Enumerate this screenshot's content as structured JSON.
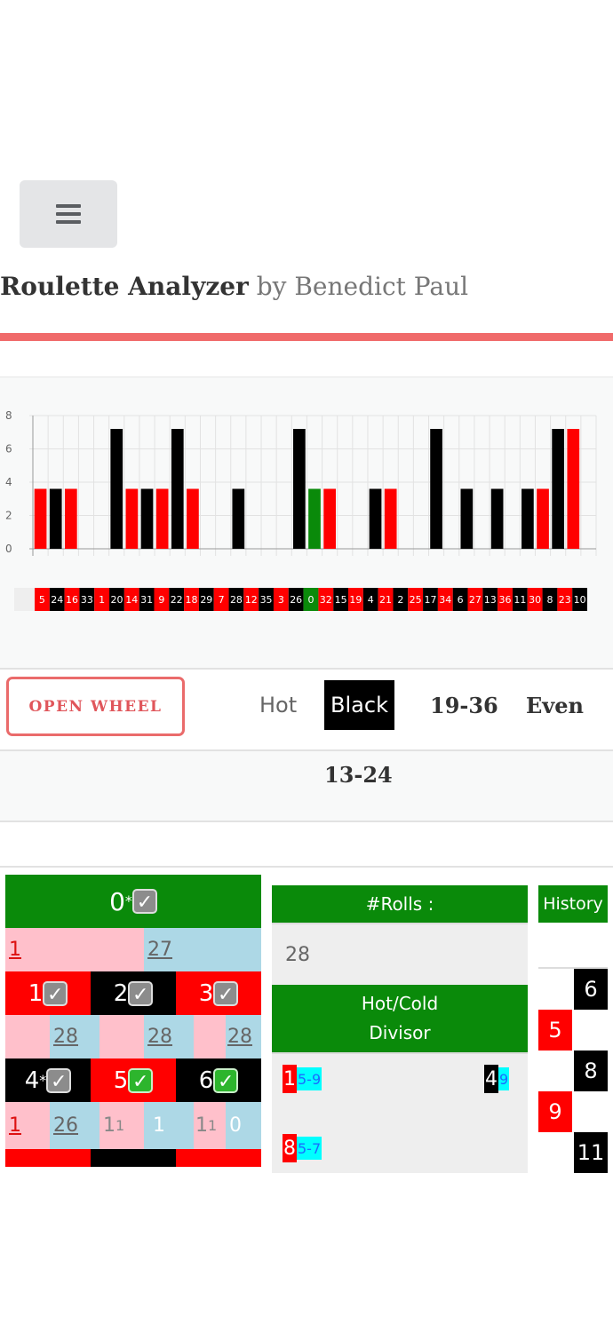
{
  "header": {
    "title": "Roulette Analyzer",
    "byline": "by Benedict Paul"
  },
  "chart_data": {
    "type": "bar",
    "ylim": [
      0,
      8
    ],
    "yticks": [
      "0",
      "2",
      "4",
      "6",
      "8"
    ],
    "grid": true,
    "categories": [
      "5",
      "24",
      "16",
      "33",
      "1",
      "20",
      "14",
      "31",
      "9",
      "22",
      "18",
      "29",
      "7",
      "28",
      "12",
      "35",
      "3",
      "26",
      "0",
      "32",
      "15",
      "19",
      "4",
      "21",
      "2",
      "25",
      "17",
      "34",
      "6",
      "27",
      "13",
      "36",
      "11",
      "30",
      "8",
      "23",
      "10"
    ],
    "colors": [
      "red",
      "black",
      "red",
      "black",
      "red",
      "black",
      "red",
      "black",
      "red",
      "black",
      "red",
      "black",
      "red",
      "black",
      "red",
      "black",
      "red",
      "black",
      "green",
      "red",
      "black",
      "red",
      "black",
      "red",
      "black",
      "red",
      "black",
      "red",
      "black",
      "red",
      "black",
      "red",
      "black",
      "red",
      "black",
      "red",
      "black"
    ],
    "values": [
      3.6,
      3.6,
      3.6,
      0,
      0,
      7.2,
      3.6,
      3.6,
      3.6,
      7.2,
      3.6,
      0,
      0,
      3.6,
      0,
      0,
      0,
      7.2,
      3.6,
      3.6,
      0,
      0,
      3.6,
      3.6,
      0,
      0,
      7.2,
      0,
      3.6,
      0,
      3.6,
      0,
      3.6,
      3.6,
      7.2,
      7.2,
      0
    ]
  },
  "controls": {
    "open_wheel": "OPEN WHEEL",
    "hot": "Hot",
    "color": "Black",
    "range": "19-36",
    "parity": "Even",
    "dozen": "13-24"
  },
  "board": {
    "zero_label": "0",
    "zero_star": "*",
    "rows": [
      {
        "stats": [
          {
            "a": "1",
            "b": "27"
          }
        ],
        "cells": [
          {
            "num": "1",
            "color": "red",
            "star": "",
            "check": "grey"
          },
          {
            "num": "2",
            "color": "black",
            "star": "",
            "check": "grey"
          },
          {
            "num": "3",
            "color": "red",
            "star": "",
            "check": "grey"
          }
        ],
        "sub": [
          "28",
          "28",
          "28"
        ]
      },
      {
        "cells": [
          {
            "num": "4",
            "color": "black",
            "star": "*",
            "check": "grey"
          },
          {
            "num": "5",
            "color": "red",
            "star": "",
            "check": "green"
          },
          {
            "num": "6",
            "color": "black",
            "star": "",
            "check": "green"
          }
        ],
        "sub": [
          {
            "a": "1",
            "b": "26"
          },
          {
            "a": "1",
            "sup": "1",
            "b": "1"
          },
          {
            "a": "1",
            "sup": "1",
            "b": "0"
          }
        ]
      }
    ],
    "check_mark": "✓"
  },
  "rolls": {
    "header": "#Rolls :",
    "value": "28"
  },
  "hotcold": {
    "header_line1": "Hot/Cold",
    "header_line2": "Divisor",
    "items": [
      {
        "num": "1",
        "color": "red",
        "div": "5-9"
      },
      {
        "num": "4",
        "color": "black",
        "div": "9"
      },
      {
        "num": "8",
        "color": "red",
        "div": "5-7"
      }
    ]
  },
  "history": {
    "header": "History",
    "items": [
      {
        "num": "6",
        "color": "black",
        "side": "right"
      },
      {
        "num": "5",
        "color": "red",
        "side": "left"
      },
      {
        "num": "8",
        "color": "black",
        "side": "right"
      },
      {
        "num": "9",
        "color": "red",
        "side": "left"
      },
      {
        "num": "11",
        "color": "black",
        "side": "right"
      }
    ]
  }
}
